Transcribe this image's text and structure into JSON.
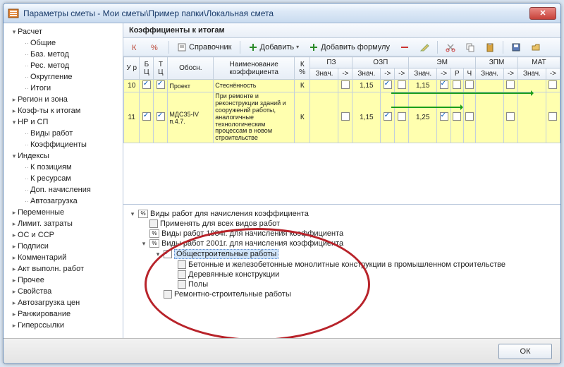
{
  "window": {
    "title": "Параметры сметы - Мои сметы\\Пример папки\\Локальная смета"
  },
  "sidebar": {
    "items": [
      {
        "label": "Расчет",
        "level": 0,
        "exp": true
      },
      {
        "label": "Общие",
        "level": 1
      },
      {
        "label": "Баз. метод",
        "level": 1
      },
      {
        "label": "Рес. метод",
        "level": 1
      },
      {
        "label": "Округление",
        "level": 1
      },
      {
        "label": "Итоги",
        "level": 1
      },
      {
        "label": "Регион и зона",
        "level": 0
      },
      {
        "label": "Коэф-ты к итогам",
        "level": 0,
        "sel": true
      },
      {
        "label": "НР и СП",
        "level": 0,
        "exp": true
      },
      {
        "label": "Виды работ",
        "level": 1
      },
      {
        "label": "Коэффициенты",
        "level": 1
      },
      {
        "label": "Индексы",
        "level": 0,
        "exp": true
      },
      {
        "label": "К позициям",
        "level": 1
      },
      {
        "label": "К ресурсам",
        "level": 1
      },
      {
        "label": "Доп. начисления",
        "level": 1
      },
      {
        "label": "Автозагрузка",
        "level": 1
      },
      {
        "label": "Переменные",
        "level": 0
      },
      {
        "label": "Лимит. затраты",
        "level": 0
      },
      {
        "label": "ОС и ССР",
        "level": 0
      },
      {
        "label": "Подписи",
        "level": 0
      },
      {
        "label": "Комментарий",
        "level": 0
      },
      {
        "label": "Акт выполн. работ",
        "level": 0
      },
      {
        "label": "Прочее",
        "level": 0
      },
      {
        "label": "Свойства",
        "level": 0
      },
      {
        "label": "Автозагрузка цен",
        "level": 0
      },
      {
        "label": "Ранжирование",
        "level": 0
      },
      {
        "label": "Гиперссылки",
        "level": 0
      }
    ]
  },
  "main": {
    "section_title": "Коэффициенты к итогам",
    "toolbar": {
      "ref": "Справочник",
      "add": "Добавить",
      "add_formula": "Добавить формулу"
    },
    "grid": {
      "headers": {
        "ur": "У\nр",
        "bc": "Б\nЦ",
        "tc": "Т\nЦ",
        "obosn": "Обосн.",
        "name": "Наименование коэффициента",
        "k": "К\n%",
        "pz": "ПЗ",
        "ozp": "ОЗП",
        "em": "ЭМ",
        "zpm": "ЗПМ",
        "mat": "МАТ",
        "znach": "Знач.",
        "arr": "->",
        "r": "Р",
        "ch": "Ч"
      },
      "rows": [
        {
          "ur": "10",
          "obosn": "Проект",
          "name": "Стеснённость",
          "k": "К",
          "ozp_zn": "1,15",
          "ozp_ck": true,
          "em_zn": "1,15",
          "em_ck": true
        },
        {
          "ur": "11",
          "obosn": "МДС35-IV п.4.7.",
          "name": "При ремонте и реконструкции зданий и сооружений работы, аналогичные технологическим процессам в новом строительстве",
          "k": "К",
          "ozp_zn": "1,15",
          "ozp_ck": true,
          "em_zn": "1,25",
          "em_ck": true
        }
      ]
    },
    "tree": [
      {
        "level": 0,
        "exp": true,
        "ico": "%",
        "label": "Виды работ для начисления коэффициента"
      },
      {
        "level": 1,
        "ck": false,
        "label": "Применять для всех видов работ"
      },
      {
        "level": 1,
        "ico": "%",
        "label": "Виды работ 1984г. для начисления коэффициента"
      },
      {
        "level": 1,
        "exp": true,
        "ico": "%",
        "label": "Виды работ 2001г. для начисления коэффициента"
      },
      {
        "level": 2,
        "exp": true,
        "ck": true,
        "label": "Общестроительные работы",
        "sel": true
      },
      {
        "level": 3,
        "ck": false,
        "label": "Бетонные и железобетонные монолитные конструкции в промышленном строительстве"
      },
      {
        "level": 3,
        "ck": false,
        "label": "Деревянные конструкции"
      },
      {
        "level": 3,
        "ck": false,
        "label": "Полы"
      },
      {
        "level": 2,
        "ck": false,
        "label": "Ремонтно-строительные работы"
      }
    ]
  },
  "footer": {
    "ok": "ОК"
  }
}
